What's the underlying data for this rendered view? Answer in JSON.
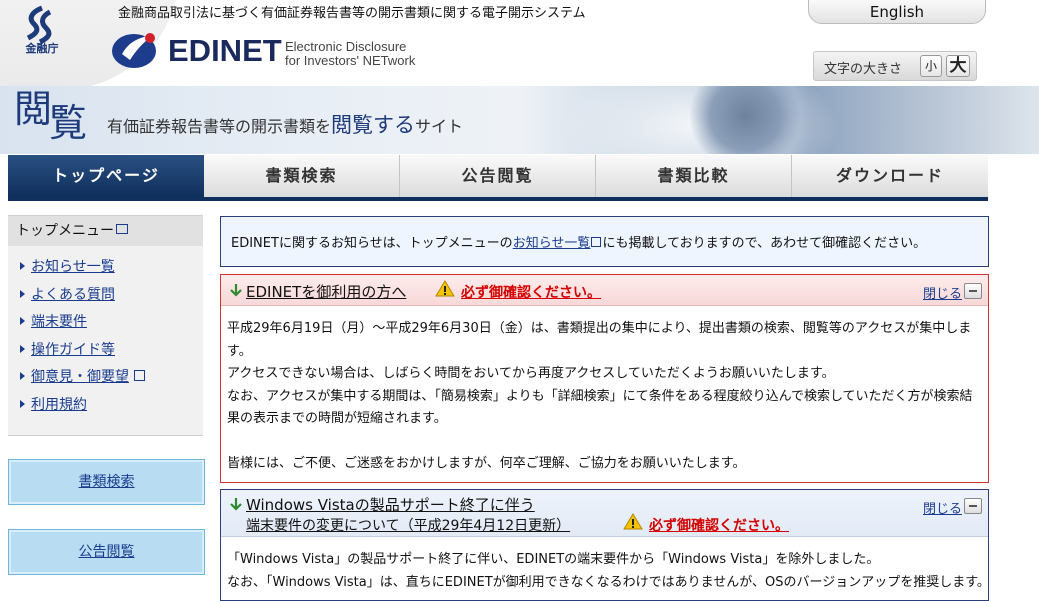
{
  "header": {
    "agency_name": "金融庁",
    "tagline": "金融商品取引法に基づく有価証券報告書等の開示書類に関する電子開示システム",
    "english_label": "English",
    "logo_text": "EDINET",
    "logo_sub_line1": "Electronic Disclosure",
    "logo_sub_line2": "for Investors' NETwork",
    "font_size_label": "文字の大きさ",
    "font_small": "小",
    "font_large": "大"
  },
  "banner": {
    "kanji_1": "閲",
    "kanji_2": "覧",
    "text_pre": "有価証券報告書等の開示書類を",
    "text_big": "閲覧する",
    "text_post": "サイト"
  },
  "nav": {
    "tabs": [
      {
        "label": "トップページ"
      },
      {
        "label": "書類検索"
      },
      {
        "label": "公告閲覧"
      },
      {
        "label": "書類比較"
      },
      {
        "label": "ダウンロード"
      }
    ]
  },
  "sidebar": {
    "heading": "トップメニュー",
    "items": [
      {
        "label": "お知らせ一覧"
      },
      {
        "label": "よくある質問"
      },
      {
        "label": "端末要件"
      },
      {
        "label": "操作ガイド等"
      },
      {
        "label": "御意見・御要望"
      },
      {
        "label": "利用規約"
      }
    ],
    "btn_search": "書類検索",
    "btn_public": "公告閲覧"
  },
  "notice": {
    "pre": "EDINETに関するお知らせは、トップメニューの",
    "link": "お知らせ一覧",
    "post": "にも掲載しておりますので、あわせて御確認ください。"
  },
  "box1": {
    "title": "EDINETを御利用の方へ",
    "warning": "必ず御確認ください。",
    "close": "閉じる",
    "p1": "平成29年6月19日（月）～平成29年6月30日（金）は、書類提出の集中により、提出書類の検索、閲覧等のアクセスが集中します。",
    "p2": "アクセスできない場合は、しばらく時間をおいてから再度アクセスしていただくようお願いいたします。",
    "p3": "なお、アクセスが集中する期間は、「簡易検索」よりも「詳細検索」にて条件をある程度絞り込んで検索していただく方が検索結果の表示までの時間が短縮されます。",
    "p4": "皆様には、ご不便、ご迷惑をおかけしますが、何卒ご理解、ご協力をお願いいたします。"
  },
  "box2": {
    "title_line1": "Windows Vistaの製品サポート終了に伴う",
    "title_line2": "端末要件の変更について（平成29年4月12日更新）",
    "warning": "必ず御確認ください。",
    "close": "閉じる",
    "p1": "「Windows Vista」の製品サポート終了に伴い、EDINETの端末要件から「Windows Vista」を除外しました。",
    "p2": "なお、「Windows Vista」は、直ちにEDINETが御利用できなくなるわけではありませんが、OSのバージョンアップを推奨します。"
  },
  "colors": {
    "nav_active": "#0f2f5c",
    "link": "#1a3c8f",
    "warning": "#d40000",
    "sidebar_button": "#b8dcf1"
  }
}
